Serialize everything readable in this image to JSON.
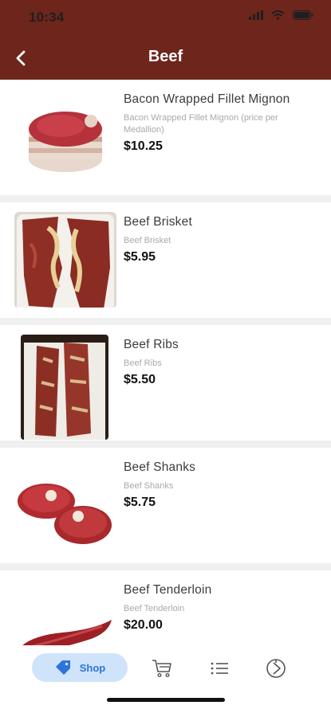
{
  "status": {
    "time": "10:34"
  },
  "header": {
    "title": "Beef",
    "back_icon": "chevron-left-icon"
  },
  "products": [
    {
      "name": "Bacon Wrapped Fillet Mignon",
      "description": "Bacon Wrapped Fillet Mignon (price per Medallion)",
      "price": "$10.25"
    },
    {
      "name": "Beef Brisket",
      "description": "Beef Brisket",
      "price": "$5.95"
    },
    {
      "name": "Beef Ribs",
      "description": "Beef Ribs",
      "price": "$5.50"
    },
    {
      "name": "Beef Shanks",
      "description": "Beef Shanks",
      "price": "$5.75"
    },
    {
      "name": "Beef Tenderloin",
      "description": "Beef Tenderloin",
      "price": "$20.00"
    }
  ],
  "tabbar": {
    "shop_label": "Shop",
    "tabs": [
      "tag-icon",
      "cart-icon",
      "list-icon",
      "settings-icon"
    ],
    "active_color": "#2d74d8",
    "active_bg": "#cfe3fb"
  },
  "colors": {
    "header": "#6e251c"
  }
}
